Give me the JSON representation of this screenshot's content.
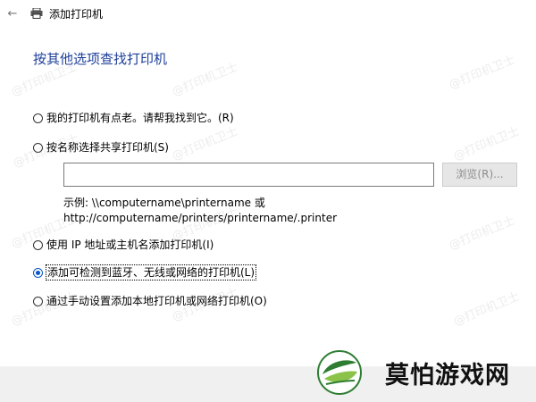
{
  "window": {
    "title": "添加打印机",
    "back_icon": "arrow-left-icon",
    "app_icon": "printer-icon"
  },
  "heading": "按其他选项查找打印机",
  "options": [
    {
      "label": "我的打印机有点老。请帮我找到它。(R)",
      "selected": false
    },
    {
      "label": "按名称选择共享打印机(S)",
      "selected": false
    },
    {
      "label": "使用 IP 地址或主机名添加打印机(I)",
      "selected": false
    },
    {
      "label": "添加可检测到蓝牙、无线或网络的打印机(L)",
      "selected": true
    },
    {
      "label": "通过手动设置添加本地打印机或网络打印机(O)",
      "selected": false
    }
  ],
  "share": {
    "value": "",
    "browse_label": "浏览(R)..."
  },
  "example": {
    "line1": "示例: \\\\computername\\printername 或",
    "line2": "http://computername/printers/printername/.printer"
  },
  "watermark_text": "@打印机卫士",
  "logo": {
    "text": "莫怕游戏网",
    "colors": {
      "leaf_dark": "#2e7d32",
      "leaf_light": "#8bc34a"
    }
  },
  "colors": {
    "heading": "#1e3f9a",
    "accent": "#0a57c7",
    "footer_bg": "#f0f0f0",
    "button_disabled_bg": "#e6e6e6"
  }
}
